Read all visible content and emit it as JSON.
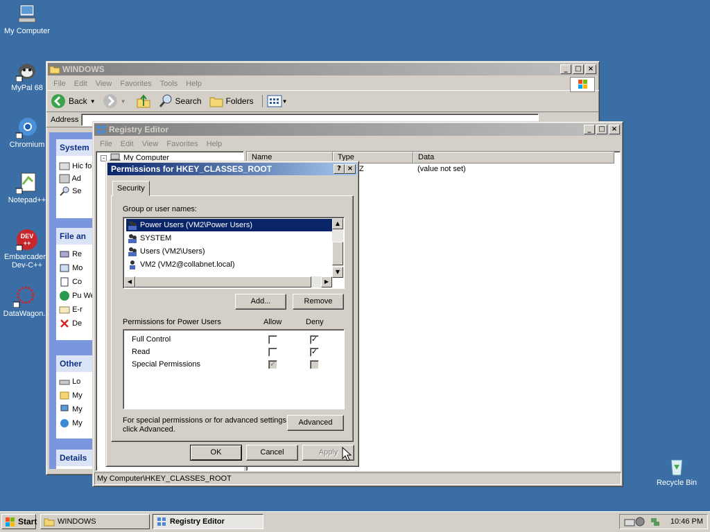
{
  "desktop": {
    "icons": [
      {
        "label": "My Computer"
      },
      {
        "label": "MyPal 68"
      },
      {
        "label": "Chromium"
      },
      {
        "label": "Notepad++"
      },
      {
        "label": "Embarcadero Dev-C++"
      },
      {
        "label": "DataWagon."
      },
      {
        "label": "Recycle Bin"
      }
    ],
    "devcpp_badge": "DEV\n++"
  },
  "explorer": {
    "title": "WINDOWS",
    "menu": [
      "File",
      "Edit",
      "View",
      "Favorites",
      "Tools",
      "Help"
    ],
    "toolbar": {
      "back": "Back",
      "search": "Search",
      "folders": "Folders"
    },
    "address_label": "Address",
    "panel_system": {
      "title": "System",
      "items": [
        "Hic fol",
        "Ad",
        "Se"
      ]
    },
    "panel_file": {
      "title": "File an",
      "items": [
        "Re",
        "Mo",
        "Co",
        "Pu We",
        "E-r",
        "De"
      ]
    },
    "panel_other": {
      "title": "Other",
      "items": [
        "Lo",
        "My",
        "My",
        "My"
      ]
    },
    "panel_details": {
      "title": "Details"
    }
  },
  "regedit": {
    "title": "Registry Editor",
    "menu": [
      "File",
      "Edit",
      "View",
      "Favorites",
      "Help"
    ],
    "tree_root": "My Computer",
    "columns": [
      "Name",
      "Type",
      "Data"
    ],
    "row": {
      "type_fragment": "Z",
      "data": "(value not set)"
    },
    "statusbar": "My Computer\\HKEY_CLASSES_ROOT"
  },
  "dialog": {
    "title": "Permissions for HKEY_CLASSES_ROOT",
    "tab": "Security",
    "group_label": "Group or user names:",
    "users": [
      "Power Users (VM2\\Power Users)",
      "SYSTEM",
      "Users (VM2\\Users)",
      "VM2 (VM2@collabnet.local)"
    ],
    "add_button": "Add...",
    "remove_button": "Remove",
    "perm_header": "Permissions for Power Users",
    "allow_header": "Allow",
    "deny_header": "Deny",
    "permissions": [
      {
        "name": "Full Control",
        "allow": false,
        "deny": true
      },
      {
        "name": "Read",
        "allow": false,
        "deny": true
      },
      {
        "name": "Special Permissions",
        "allow": true,
        "deny": false
      }
    ],
    "advanced_text_1": "For special permissions or for advanced settings,",
    "advanced_text_2": "click Advanced.",
    "advanced_button": "Advanced",
    "ok": "OK",
    "cancel": "Cancel",
    "apply": "Apply"
  },
  "taskbar": {
    "start": "Start",
    "tasks": [
      "WINDOWS",
      "Registry Editor"
    ],
    "clock": "10:46 PM"
  },
  "colors": {
    "desktop": "#3a6ea5",
    "title_active": "#0a246a",
    "selection": "#0a246a"
  }
}
